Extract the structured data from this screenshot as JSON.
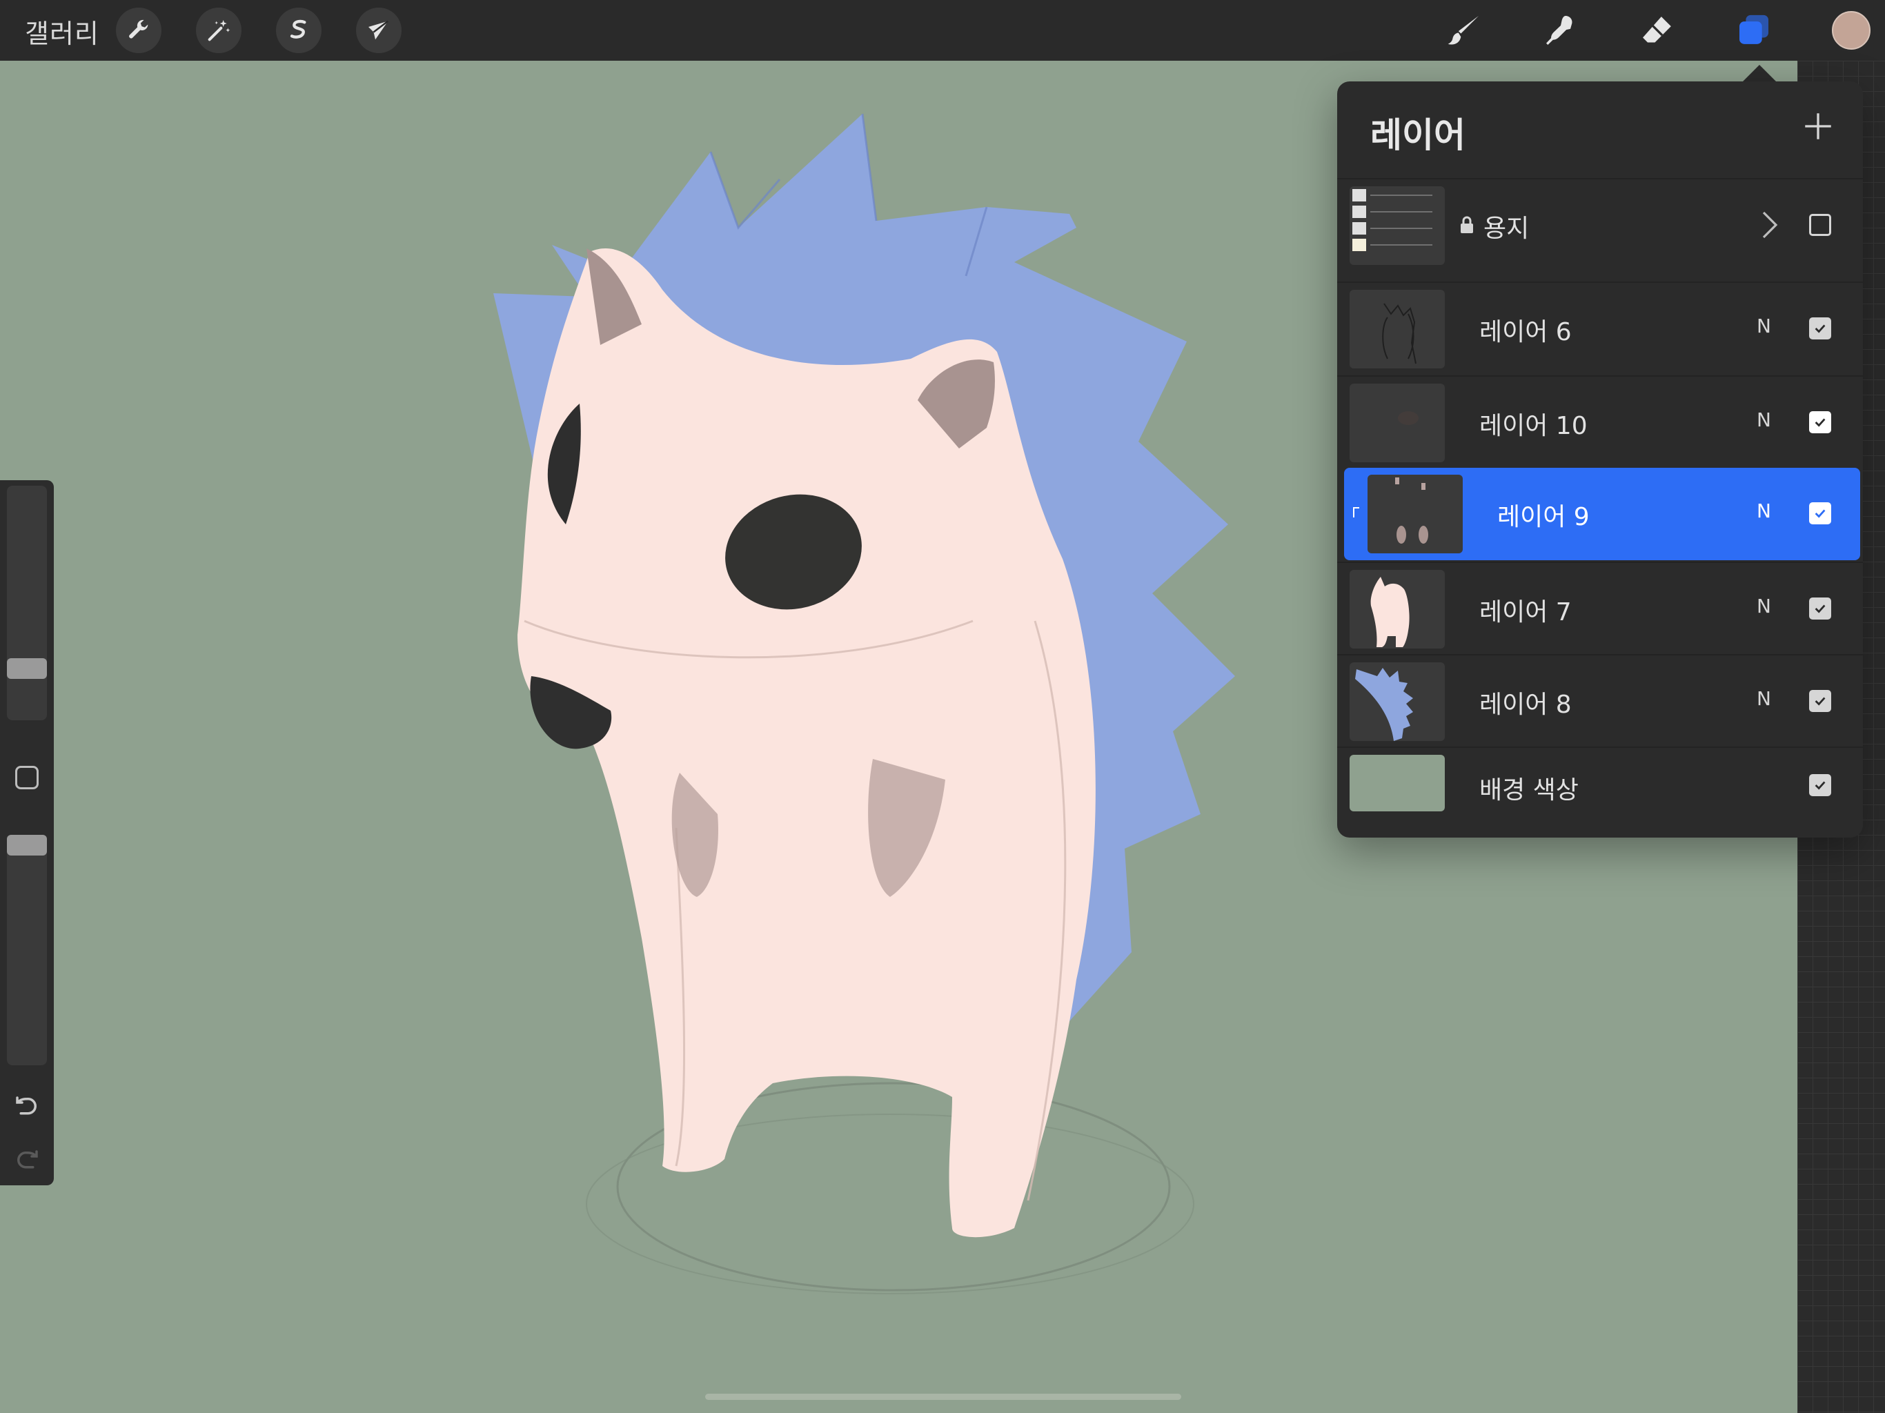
{
  "toolbar": {
    "gallery_label": "갤러리",
    "left_tools": [
      "wrench-icon",
      "magic-wand-icon",
      "selection-s-icon",
      "transform-arrow-icon"
    ],
    "right_tools": [
      "brush-icon",
      "smudge-icon",
      "eraser-icon",
      "layers-icon"
    ],
    "active_color": "#c3a496",
    "layers_icon_color": "#2d6df5"
  },
  "canvas": {
    "background": "#8fa18f",
    "character": "hedgehog-sketch"
  },
  "sidebar": {
    "brush_size_level": 0.25,
    "opacity_level": 0.97,
    "tools": [
      "brush-size-slider",
      "modify-button",
      "opacity-slider",
      "undo-icon",
      "redo-icon"
    ]
  },
  "layers_panel": {
    "title": "레이어",
    "add_icon": "plus-icon",
    "layers": [
      {
        "name": "용지",
        "locked": true,
        "type": "group",
        "checked": false
      },
      {
        "name": "레이어 6",
        "blend": "N",
        "checked": true
      },
      {
        "name": "레이어 10",
        "blend": "N",
        "checked": true
      },
      {
        "name": "레이어 9",
        "blend": "N",
        "checked": true,
        "active": true,
        "clipped": true
      },
      {
        "name": "레이어 7",
        "blend": "N",
        "checked": true
      },
      {
        "name": "레이어 8",
        "blend": "N",
        "checked": true
      },
      {
        "name": "배경 색상",
        "checked": true,
        "color": "#8fa18f"
      }
    ]
  }
}
